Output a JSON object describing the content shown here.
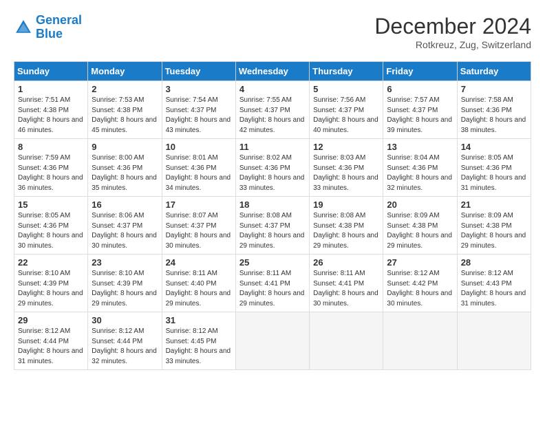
{
  "logo": {
    "line1": "General",
    "line2": "Blue"
  },
  "title": "December 2024",
  "location": "Rotkreuz, Zug, Switzerland",
  "weekdays": [
    "Sunday",
    "Monday",
    "Tuesday",
    "Wednesday",
    "Thursday",
    "Friday",
    "Saturday"
  ],
  "weeks": [
    [
      {
        "day": "1",
        "sunrise": "7:51 AM",
        "sunset": "4:38 PM",
        "daylight": "8 hours and 46 minutes."
      },
      {
        "day": "2",
        "sunrise": "7:53 AM",
        "sunset": "4:38 PM",
        "daylight": "8 hours and 45 minutes."
      },
      {
        "day": "3",
        "sunrise": "7:54 AM",
        "sunset": "4:37 PM",
        "daylight": "8 hours and 43 minutes."
      },
      {
        "day": "4",
        "sunrise": "7:55 AM",
        "sunset": "4:37 PM",
        "daylight": "8 hours and 42 minutes."
      },
      {
        "day": "5",
        "sunrise": "7:56 AM",
        "sunset": "4:37 PM",
        "daylight": "8 hours and 40 minutes."
      },
      {
        "day": "6",
        "sunrise": "7:57 AM",
        "sunset": "4:37 PM",
        "daylight": "8 hours and 39 minutes."
      },
      {
        "day": "7",
        "sunrise": "7:58 AM",
        "sunset": "4:36 PM",
        "daylight": "8 hours and 38 minutes."
      }
    ],
    [
      {
        "day": "8",
        "sunrise": "7:59 AM",
        "sunset": "4:36 PM",
        "daylight": "8 hours and 36 minutes."
      },
      {
        "day": "9",
        "sunrise": "8:00 AM",
        "sunset": "4:36 PM",
        "daylight": "8 hours and 35 minutes."
      },
      {
        "day": "10",
        "sunrise": "8:01 AM",
        "sunset": "4:36 PM",
        "daylight": "8 hours and 34 minutes."
      },
      {
        "day": "11",
        "sunrise": "8:02 AM",
        "sunset": "4:36 PM",
        "daylight": "8 hours and 33 minutes."
      },
      {
        "day": "12",
        "sunrise": "8:03 AM",
        "sunset": "4:36 PM",
        "daylight": "8 hours and 33 minutes."
      },
      {
        "day": "13",
        "sunrise": "8:04 AM",
        "sunset": "4:36 PM",
        "daylight": "8 hours and 32 minutes."
      },
      {
        "day": "14",
        "sunrise": "8:05 AM",
        "sunset": "4:36 PM",
        "daylight": "8 hours and 31 minutes."
      }
    ],
    [
      {
        "day": "15",
        "sunrise": "8:05 AM",
        "sunset": "4:36 PM",
        "daylight": "8 hours and 30 minutes."
      },
      {
        "day": "16",
        "sunrise": "8:06 AM",
        "sunset": "4:37 PM",
        "daylight": "8 hours and 30 minutes."
      },
      {
        "day": "17",
        "sunrise": "8:07 AM",
        "sunset": "4:37 PM",
        "daylight": "8 hours and 30 minutes."
      },
      {
        "day": "18",
        "sunrise": "8:08 AM",
        "sunset": "4:37 PM",
        "daylight": "8 hours and 29 minutes."
      },
      {
        "day": "19",
        "sunrise": "8:08 AM",
        "sunset": "4:38 PM",
        "daylight": "8 hours and 29 minutes."
      },
      {
        "day": "20",
        "sunrise": "8:09 AM",
        "sunset": "4:38 PM",
        "daylight": "8 hours and 29 minutes."
      },
      {
        "day": "21",
        "sunrise": "8:09 AM",
        "sunset": "4:38 PM",
        "daylight": "8 hours and 29 minutes."
      }
    ],
    [
      {
        "day": "22",
        "sunrise": "8:10 AM",
        "sunset": "4:39 PM",
        "daylight": "8 hours and 29 minutes."
      },
      {
        "day": "23",
        "sunrise": "8:10 AM",
        "sunset": "4:39 PM",
        "daylight": "8 hours and 29 minutes."
      },
      {
        "day": "24",
        "sunrise": "8:11 AM",
        "sunset": "4:40 PM",
        "daylight": "8 hours and 29 minutes."
      },
      {
        "day": "25",
        "sunrise": "8:11 AM",
        "sunset": "4:41 PM",
        "daylight": "8 hours and 29 minutes."
      },
      {
        "day": "26",
        "sunrise": "8:11 AM",
        "sunset": "4:41 PM",
        "daylight": "8 hours and 30 minutes."
      },
      {
        "day": "27",
        "sunrise": "8:12 AM",
        "sunset": "4:42 PM",
        "daylight": "8 hours and 30 minutes."
      },
      {
        "day": "28",
        "sunrise": "8:12 AM",
        "sunset": "4:43 PM",
        "daylight": "8 hours and 31 minutes."
      }
    ],
    [
      {
        "day": "29",
        "sunrise": "8:12 AM",
        "sunset": "4:44 PM",
        "daylight": "8 hours and 31 minutes."
      },
      {
        "day": "30",
        "sunrise": "8:12 AM",
        "sunset": "4:44 PM",
        "daylight": "8 hours and 32 minutes."
      },
      {
        "day": "31",
        "sunrise": "8:12 AM",
        "sunset": "4:45 PM",
        "daylight": "8 hours and 33 minutes."
      },
      null,
      null,
      null,
      null
    ]
  ]
}
